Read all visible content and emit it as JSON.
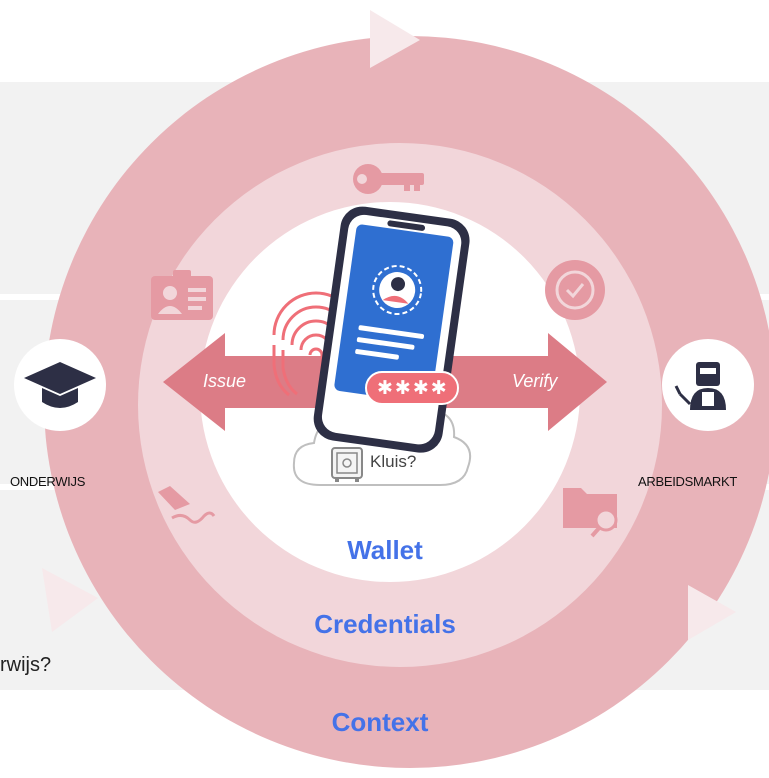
{
  "diagram": {
    "rings": {
      "outer_label": "Context",
      "middle_label": "Credentials",
      "inner_label": "Wallet"
    },
    "nodes": {
      "left": "ONDERWIJS",
      "right": "ARBEIDSMARKT"
    },
    "arrows": {
      "left": "Issue",
      "right": "Verify"
    },
    "cloud_label": "Kluis?",
    "pin_mask": "✱✱✱✱",
    "background_text": "rwijs?",
    "icons": [
      "key-icon",
      "id-card-icon",
      "badge-check-icon",
      "signature-icon",
      "folder-search-icon",
      "graduation-cap-icon",
      "welder-icon",
      "fingerprint-icon",
      "phone-icon",
      "safe-icon"
    ],
    "colors": {
      "outer_ring": "#e8b3b9",
      "middle_ring": "#f2d6da",
      "inner_disc": "#ffffff",
      "arrow": "#dc7c86",
      "title": "#4472e8",
      "background_band": "#f2f2f2",
      "phone_screen": "#2f6fd1"
    }
  }
}
